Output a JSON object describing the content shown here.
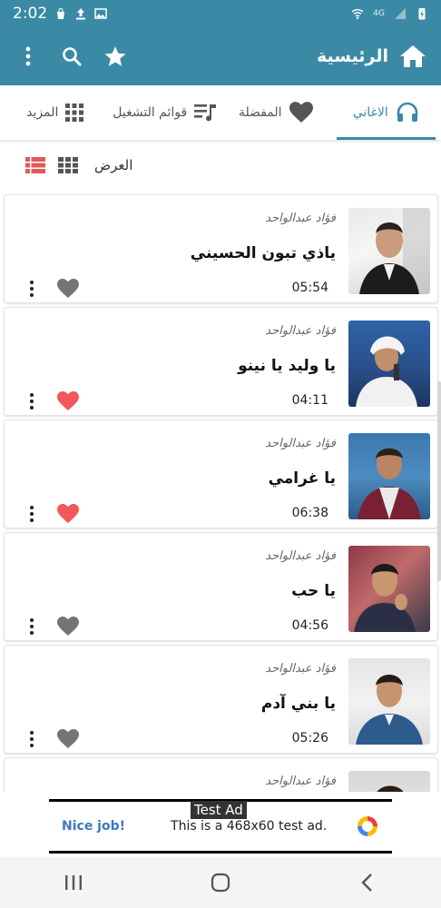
{
  "status_bar": {
    "time": "2:02",
    "network_label": "4G"
  },
  "app_bar": {
    "title": "الرئيسية"
  },
  "tabs": [
    {
      "label": "الاغاني",
      "icon": "headphones-icon",
      "active": true
    },
    {
      "label": "المفضلة",
      "icon": "heart-icon",
      "active": false
    },
    {
      "label": "قوائم التشغيل",
      "icon": "playlist-icon",
      "active": false
    },
    {
      "label": "المزيد",
      "icon": "grid-icon",
      "active": false
    }
  ],
  "view": {
    "label": "العرض"
  },
  "songs": [
    {
      "artist": "فؤاد عبدالواحد",
      "title": "ياذي تبون الحسيني",
      "duration": "05:54",
      "favorite": false
    },
    {
      "artist": "فؤاد عبدالواحد",
      "title": "يا وليد يا نينو",
      "duration": "04:11",
      "favorite": true
    },
    {
      "artist": "فؤاد عبدالواحد",
      "title": "يا غرامي",
      "duration": "06:38",
      "favorite": true
    },
    {
      "artist": "فؤاد عبدالواحد",
      "title": "يا حب",
      "duration": "04:56",
      "favorite": false
    },
    {
      "artist": "فؤاد عبدالواحد",
      "title": "يا بني آدم",
      "duration": "05:26",
      "favorite": false
    },
    {
      "artist": "فؤاد عبدالواحد",
      "title": "",
      "duration": "",
      "favorite": false
    }
  ],
  "ad": {
    "badge": "Test Ad",
    "headline": "Nice job!",
    "body": "This is a 468x60 test ad."
  },
  "colors": {
    "primary": "#3b8aa5",
    "favorite": "#f2575b",
    "not_favorite": "#757575",
    "list_view_active": "#e05a5a"
  }
}
